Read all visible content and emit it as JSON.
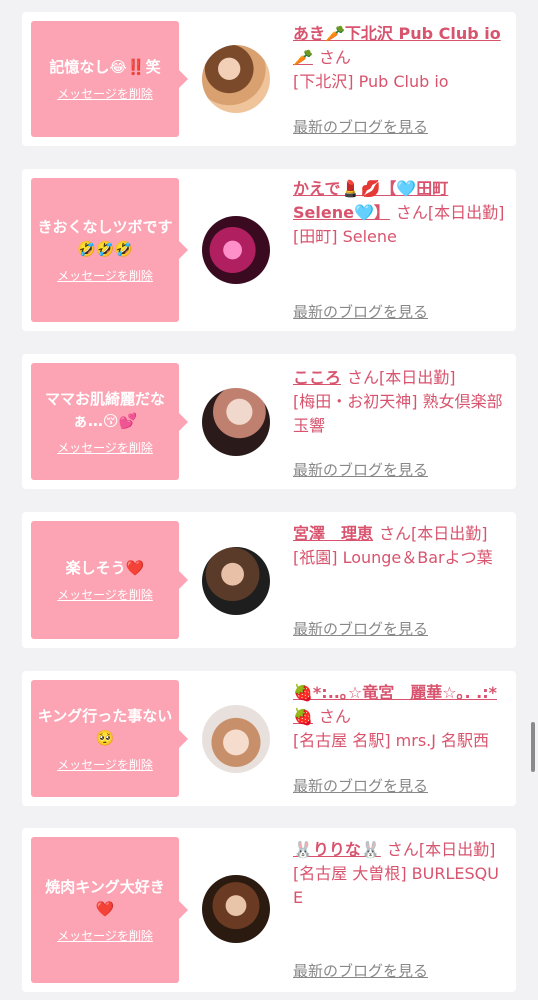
{
  "san_label": "さん",
  "delete_label": "メッセージを削除",
  "blog_label": "最新のブログを見る",
  "cards": [
    {
      "message": "記憶なし😂‼️笑",
      "name": "あき🥕下北沢 Pub Club io🥕",
      "status": "",
      "store": "[下北沢] Pub Club io"
    },
    {
      "message": "きおくなしツボです🤣🤣🤣",
      "name": "かえで💄💋【🩵田町Selene🩵】",
      "status": "[本日出勤]",
      "store": "[田町] Selene"
    },
    {
      "message": "ママお肌綺麗だなぁ…😚💕",
      "name": "こころ",
      "status": "[本日出勤]",
      "store": "[梅田・お初天神] 熟女倶楽部 玉響"
    },
    {
      "message": "楽しそう❤️",
      "name": "宮澤　理恵",
      "status": "[本日出勤]",
      "store": "[祇園] Lounge＆Barよつ葉"
    },
    {
      "message": "キング行った事ない🥺",
      "name": "🍓*:..｡☆竜宮　麗華☆｡. .:*🍓",
      "status": "",
      "store": "[名古屋 名駅] mrs.J 名駅西"
    },
    {
      "message": "焼肉キング大好き❤️",
      "name": "🐰りりな🐰",
      "status": "[本日出勤]",
      "store": "[名古屋 大曽根] BURLESQUE"
    }
  ]
}
